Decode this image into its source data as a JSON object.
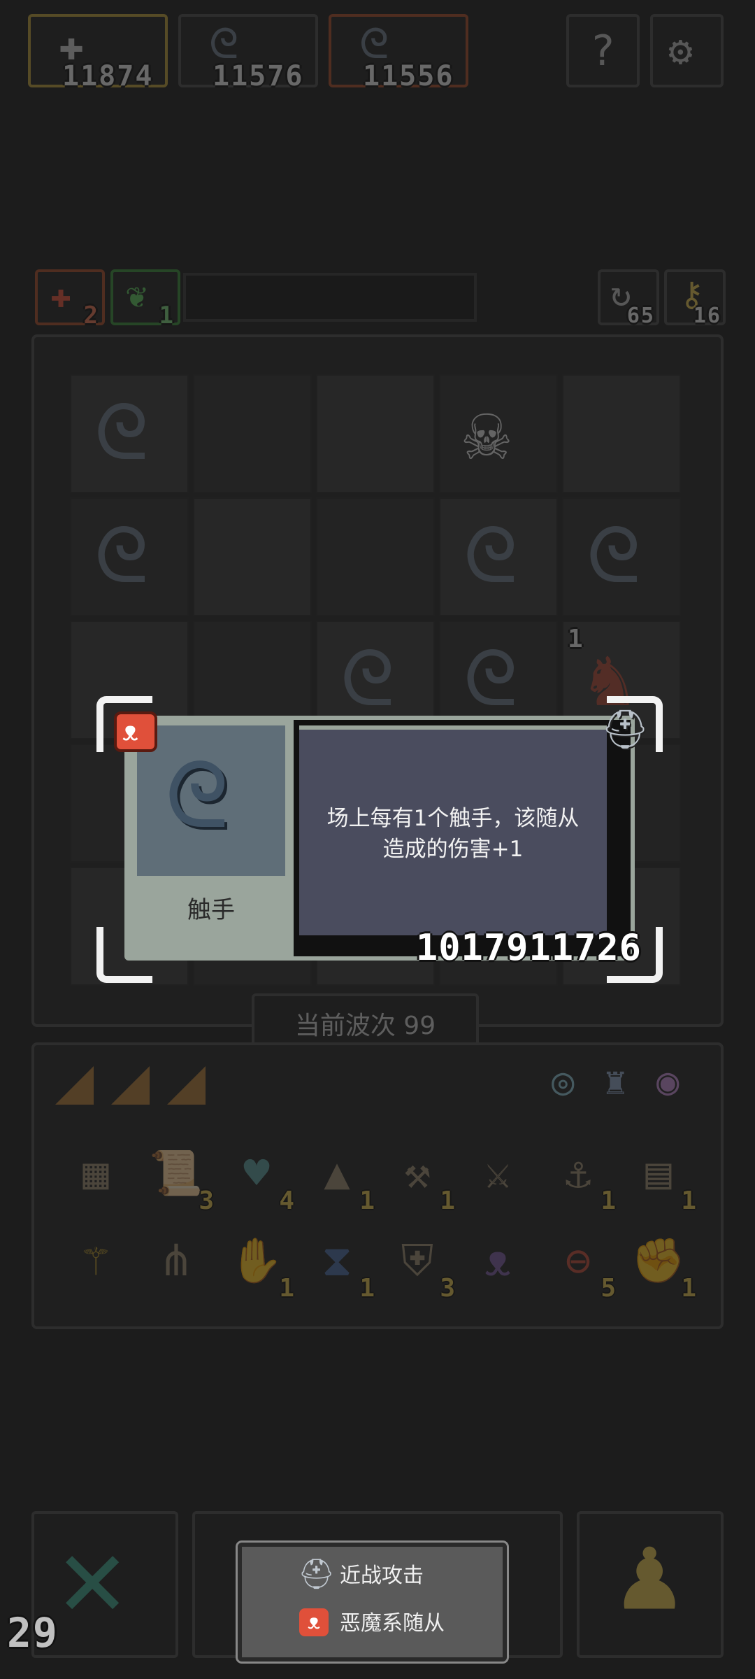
{
  "top_stats": [
    {
      "icon": "cross-icon",
      "value": "11874",
      "accent": "#b79a3a"
    },
    {
      "icon": "tentacle-icon",
      "value": "11576",
      "accent": "#5d6f7c"
    },
    {
      "icon": "tentacle-icon",
      "value": "11556",
      "accent": "#a44a2a"
    }
  ],
  "top_buttons": [
    "help-icon",
    "settings-icon"
  ],
  "status_row": {
    "left_badges": [
      {
        "icon": "demon-icon",
        "value": "2"
      },
      {
        "icon": "leaf-icon",
        "value": "1"
      }
    ],
    "right_badges": [
      {
        "icon": "refresh-icon",
        "value": "65"
      },
      {
        "icon": "key-icon",
        "value": "16"
      }
    ]
  },
  "board": {
    "wave_label": "当前波次 99",
    "pieces": [
      {
        "row": 0,
        "col": 0,
        "icon": "tentacle-icon"
      },
      {
        "row": 0,
        "col": 3,
        "icon": "skeleton-icon"
      },
      {
        "row": 1,
        "col": 0,
        "icon": "tentacle-icon"
      },
      {
        "row": 1,
        "col": 3,
        "icon": "tentacle-icon"
      },
      {
        "row": 1,
        "col": 4,
        "icon": "tentacle-icon"
      },
      {
        "row": 2,
        "col": 2,
        "icon": "tentacle-icon"
      },
      {
        "row": 2,
        "col": 3,
        "icon": "tentacle-icon"
      },
      {
        "row": 2,
        "col": 4,
        "icon": "demon-knight-icon",
        "level": "1"
      }
    ]
  },
  "inventory": {
    "tabs": [
      "tab-1",
      "tab-2",
      "tab-3"
    ],
    "filters": [
      "ring-icon",
      "armor-icon",
      "amulet-icon"
    ],
    "row1": [
      {
        "icon": "book-icon",
        "count": ""
      },
      {
        "icon": "scroll-icon",
        "count": "3"
      },
      {
        "icon": "heart-icon",
        "count": "4"
      },
      {
        "icon": "cloak-icon",
        "count": "1"
      },
      {
        "icon": "axe-icon",
        "count": "1"
      },
      {
        "icon": "sword-icon",
        "count": ""
      },
      {
        "icon": "anchor-icon",
        "count": "1"
      },
      {
        "icon": "map-icon",
        "count": "1"
      }
    ],
    "row2": [
      {
        "icon": "wand-icon",
        "count": ""
      },
      {
        "icon": "claws-icon",
        "count": ""
      },
      {
        "icon": "gauntlet-icon",
        "count": "1"
      },
      {
        "icon": "hourglass-icon",
        "count": "1"
      },
      {
        "icon": "shield-icon",
        "count": "3"
      },
      {
        "icon": "bat-icon",
        "count": ""
      },
      {
        "icon": "orb-icon",
        "count": "5"
      },
      {
        "icon": "fist-icon",
        "count": "1"
      }
    ]
  },
  "popup": {
    "unit_name": "触手",
    "description_line1": "场上每有1个触手，该随从",
    "description_line2": "造成的伤害+1",
    "id_number": "1017911726",
    "type_icon": "demon-faction-icon",
    "attack_icon": "melee-helmet-icon"
  },
  "legend": {
    "melee_label": "近战攻击",
    "demon_label": "恶魔系随从"
  },
  "bottom": {
    "counter": "29",
    "left_button_icon": "close-icon",
    "right_button_icon": "pawn-icon"
  },
  "colors": {
    "background": "#1c1c1c",
    "popup_panel": "#4a4c5e",
    "popup_portrait": "#5f6e78",
    "popup_name_bg": "#9aa59c",
    "demon_badge": "#e0503a",
    "gold_count": "#e0c050"
  }
}
